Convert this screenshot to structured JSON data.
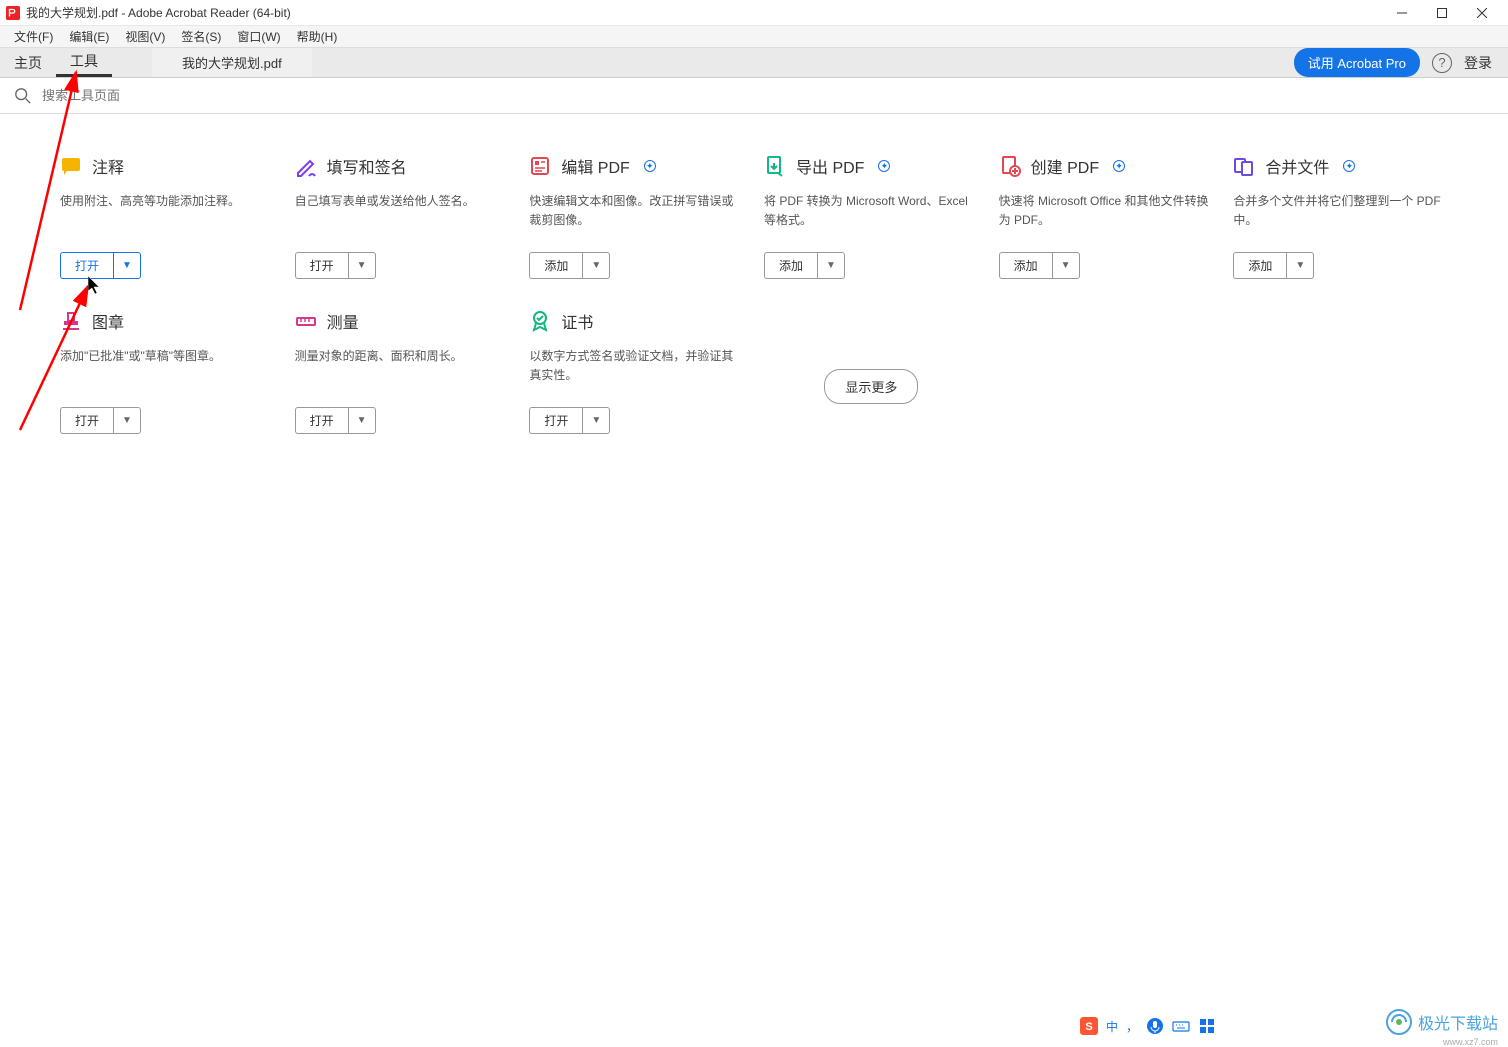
{
  "titlebar": {
    "text": "我的大学规划.pdf - Adobe Acrobat Reader (64-bit)"
  },
  "menubar": {
    "items": [
      "文件(F)",
      "编辑(E)",
      "视图(V)",
      "签名(S)",
      "窗口(W)",
      "帮助(H)"
    ]
  },
  "tabbar": {
    "home": "主页",
    "tools": "工具",
    "doc": "我的大学规划.pdf",
    "try_pro": "试用 Acrobat Pro",
    "login": "登录"
  },
  "search": {
    "placeholder": "搜索工具页面"
  },
  "tools": [
    {
      "title": "注释",
      "desc": "使用附注、高亮等功能添加注释。",
      "btn": "打开",
      "icon": "comment",
      "color": "#f5b400",
      "badge": false
    },
    {
      "title": "填写和签名",
      "desc": "自己填写表单或发送给他人签名。",
      "btn": "打开",
      "icon": "fill-sign",
      "color": "#7b3ff2",
      "badge": false
    },
    {
      "title": "编辑 PDF",
      "desc": "快速编辑文本和图像。改正拼写错误或裁剪图像。",
      "btn": "添加",
      "icon": "edit",
      "color": "#e34850",
      "badge": true
    },
    {
      "title": "导出 PDF",
      "desc": "将 PDF 转换为 Microsoft Word、Excel 等格式。",
      "btn": "添加",
      "icon": "export",
      "color": "#12b886",
      "badge": true
    },
    {
      "title": "创建 PDF",
      "desc": "快速将 Microsoft Office 和其他文件转换为 PDF。",
      "btn": "添加",
      "icon": "create",
      "color": "#e34850",
      "badge": true
    },
    {
      "title": "合并文件",
      "desc": "合并多个文件并将它们整理到一个 PDF 中。",
      "btn": "添加",
      "icon": "combine",
      "color": "#6e4bde",
      "badge": true
    },
    {
      "title": "图章",
      "desc": "添加\"已批准\"或\"草稿\"等图章。",
      "btn": "打开",
      "icon": "stamp",
      "color": "#d83790",
      "badge": false
    },
    {
      "title": "测量",
      "desc": "测量对象的距离、面积和周长。",
      "btn": "打开",
      "icon": "measure",
      "color": "#d83790",
      "badge": false
    },
    {
      "title": "证书",
      "desc": "以数字方式签名或验证文档，并验证其真实性。",
      "btn": "打开",
      "icon": "certificate",
      "color": "#12b886",
      "badge": false
    }
  ],
  "show_more": "显示更多",
  "watermark": {
    "text": "极光下载站",
    "sub": "www.xz7.com"
  },
  "ime": {
    "text": "中"
  }
}
